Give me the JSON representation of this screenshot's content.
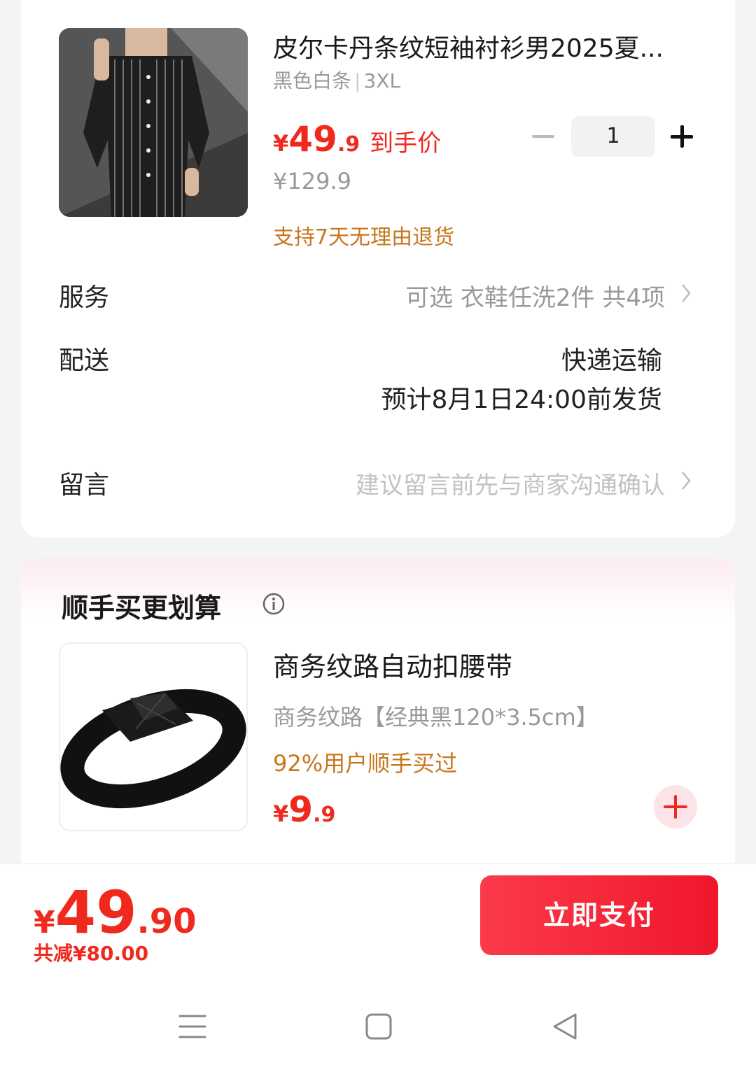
{
  "product": {
    "title": "皮尔卡丹条纹短袖衬衫男2025夏...",
    "spec_color": "黑色白条",
    "spec_size": "3XL",
    "price_symbol": "¥",
    "price_int": "49",
    "price_dec": ".9",
    "price_tag": "到手价",
    "original_price": "¥129.9",
    "return_policy": "支持7天无理由退货",
    "quantity": "1"
  },
  "service": {
    "label": "服务",
    "value": "可选 衣鞋任洗2件 共4项"
  },
  "delivery": {
    "label": "配送",
    "method": "快递运输",
    "estimate": "预计8月1日24:00前发货"
  },
  "message": {
    "label": "留言",
    "placeholder": "建议留言前先与商家沟通确认"
  },
  "addon": {
    "heading": "顺手买更划算",
    "title": "商务纹路自动扣腰带",
    "spec": "商务纹路【经典黑120*3.5cm】",
    "social_proof": "92%用户顺手买过",
    "price_symbol": "¥",
    "price_int": "9",
    "price_dec": ".9"
  },
  "pay_bar": {
    "total_symbol": "¥",
    "total_int": "49",
    "total_dec": ".90",
    "saved": "共减¥80.00",
    "pay_button": "立即支付"
  },
  "colors": {
    "accent_red": "#f0291e",
    "accent_orange": "#c7771d",
    "muted_gray": "#999999"
  },
  "icons": [
    "info-icon",
    "chevron-right-icon",
    "plus-icon",
    "minus-icon",
    "menu-icon",
    "home-icon",
    "back-icon"
  ]
}
